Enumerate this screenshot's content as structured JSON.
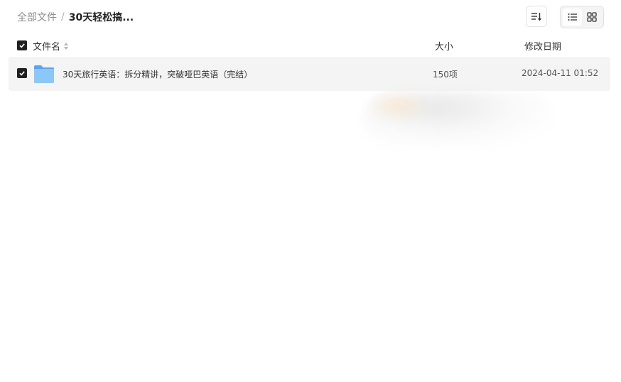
{
  "breadcrumb": {
    "root": "全部文件",
    "separator": "/",
    "current": "30天轻松搞..."
  },
  "toolbar": {
    "sort_icon": "sort-icon",
    "list_view_icon": "list-view-icon",
    "grid_view_icon": "grid-view-icon",
    "active_view": "list"
  },
  "table": {
    "columns": {
      "name": "文件名",
      "size": "大小",
      "modified": "修改日期"
    },
    "rows": [
      {
        "checked": true,
        "icon": "folder-icon",
        "name": "30天旅行英语：拆分精讲，突破哑巴英语（完结）",
        "size": "150项",
        "modified": "2024-04-11 01:52"
      }
    ]
  },
  "colors": {
    "checkbox": "#1f1f1f",
    "row_highlight": "#f4f4f4",
    "folder": "#6fb3f2"
  }
}
